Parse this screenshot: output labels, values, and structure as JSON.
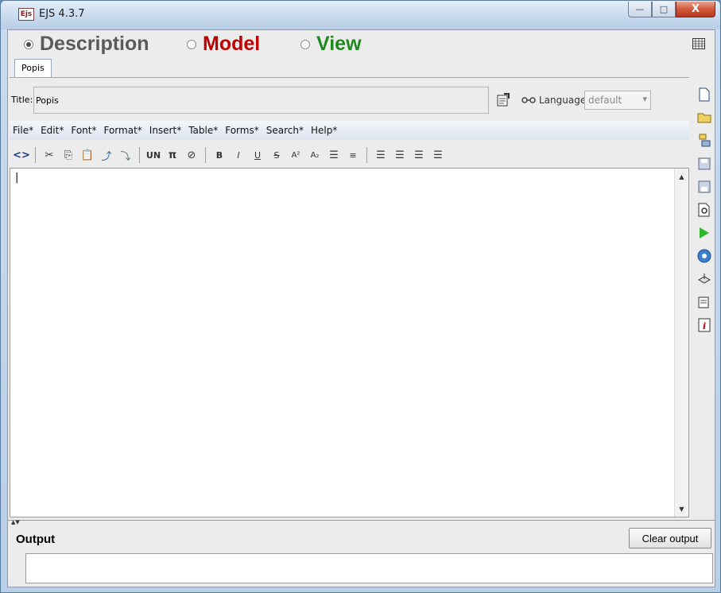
{
  "window": {
    "title": "EJS 4.3.7",
    "app_icon_text": "Ejs",
    "minimize": "—",
    "maximize": "□",
    "close": "X"
  },
  "modes": {
    "description": "Description",
    "model": "Model",
    "view": "View",
    "selected": "Description"
  },
  "tabs": [
    {
      "label": "Popis"
    }
  ],
  "title_field": {
    "label": "Title:",
    "value": "Popis"
  },
  "language": {
    "label": "Language:",
    "value": "default"
  },
  "menu": [
    "File*",
    "Edit*",
    "Font*",
    "Format*",
    "Insert*",
    "Table*",
    "Forms*",
    "Search*",
    "Help*"
  ],
  "editor": {
    "content": "|"
  },
  "output": {
    "label": "Output",
    "clear_button": "Clear output",
    "value": ""
  },
  "icons": {
    "format_toolbar": [
      "source-toggle-icon",
      "cut-icon",
      "copy-icon",
      "paste-icon",
      "insert-link-icon",
      "unlink-icon",
      "unicode-icon",
      "pi-icon",
      "clear-format-icon",
      "bold-icon",
      "italic-icon",
      "underline-icon",
      "strikethrough-icon",
      "superscript-icon",
      "subscript-icon",
      "bullet-list-icon",
      "numbered-list-icon",
      "align-left-icon",
      "align-center-icon",
      "align-right-icon",
      "align-justify-icon"
    ],
    "right_toolbar": [
      "new-file-icon",
      "open-folder-icon",
      "open-server-icon",
      "save-icon",
      "save-as-icon",
      "search-preview-icon",
      "run-icon",
      "web-icon",
      "package-icon",
      "properties-icon",
      "info-icon"
    ]
  },
  "colors": {
    "model": "#c00000",
    "view": "#1f8a1f",
    "description": "#5a5a5a",
    "close_button": "#c8452a"
  }
}
